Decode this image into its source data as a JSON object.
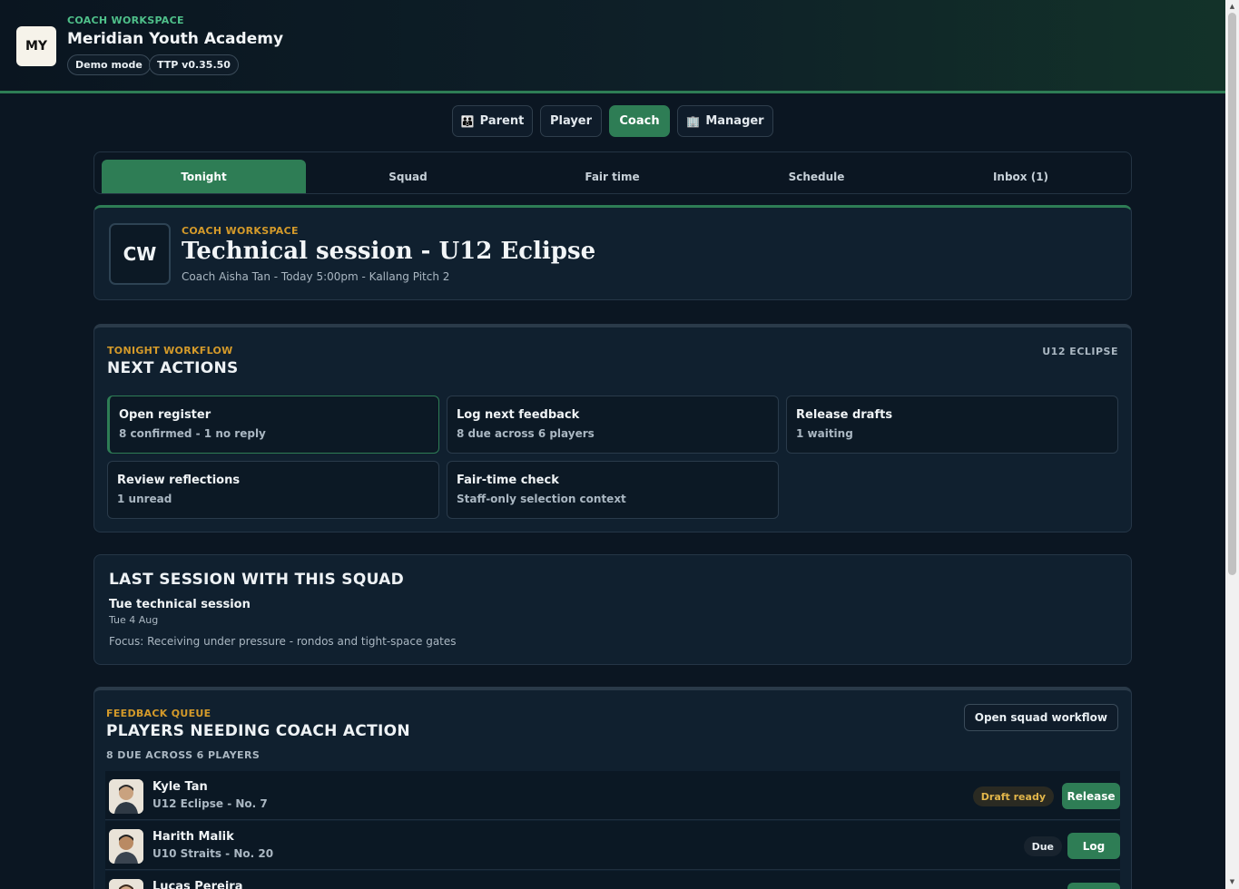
{
  "header": {
    "logo": "MY",
    "workspace_label": "COACH WORKSPACE",
    "academy": "Meridian Youth Academy",
    "pills": [
      "Demo mode",
      "TTP v0.35.50"
    ]
  },
  "roles": {
    "parent": "Parent",
    "player": "Player",
    "coach": "Coach",
    "manager": "Manager",
    "active": "Coach"
  },
  "tabs": [
    "Tonight",
    "Squad",
    "Fair time",
    "Schedule",
    "Inbox (1)"
  ],
  "session": {
    "badge": "CW",
    "eyebrow": "COACH WORKSPACE",
    "title": "Technical session - U12 Eclipse",
    "meta": "Coach Aisha Tan - Today 5:00pm - Kallang Pitch 2"
  },
  "workflow": {
    "eyebrow": "TONIGHT WORKFLOW",
    "title": "NEXT ACTIONS",
    "squad_tag": "U12 ECLIPSE",
    "actions": [
      {
        "title": "Open register",
        "sub": "8 confirmed - 1 no reply"
      },
      {
        "title": "Log next feedback",
        "sub": "8 due across 6 players"
      },
      {
        "title": "Release drafts",
        "sub": "1 waiting"
      },
      {
        "title": "Review reflections",
        "sub": "1 unread"
      },
      {
        "title": "Fair-time check",
        "sub": "Staff-only selection context"
      }
    ]
  },
  "last_session": {
    "title": "LAST SESSION WITH THIS SQUAD",
    "name": "Tue technical session",
    "date": "Tue 4 Aug",
    "focus": "Focus: Receiving under pressure - rondos and tight-space gates"
  },
  "feedback": {
    "eyebrow": "FEEDBACK QUEUE",
    "title": "PLAYERS NEEDING COACH ACTION",
    "summary": "8 DUE ACROSS 6 PLAYERS",
    "open_button": "Open squad workflow",
    "players": [
      {
        "name": "Kyle Tan",
        "team": "U12 Eclipse - No. 7",
        "status": "Draft ready",
        "action": "Release"
      },
      {
        "name": "Harith Malik",
        "team": "U10 Straits - No. 20",
        "status": "Due",
        "action": "Log"
      },
      {
        "name": "Lucas Pereira",
        "team": "",
        "status": "",
        "action": ""
      }
    ]
  },
  "colors": {
    "accent": "#2e7d55",
    "eyebrow": "#d49a2a",
    "background": "#0b1622"
  }
}
